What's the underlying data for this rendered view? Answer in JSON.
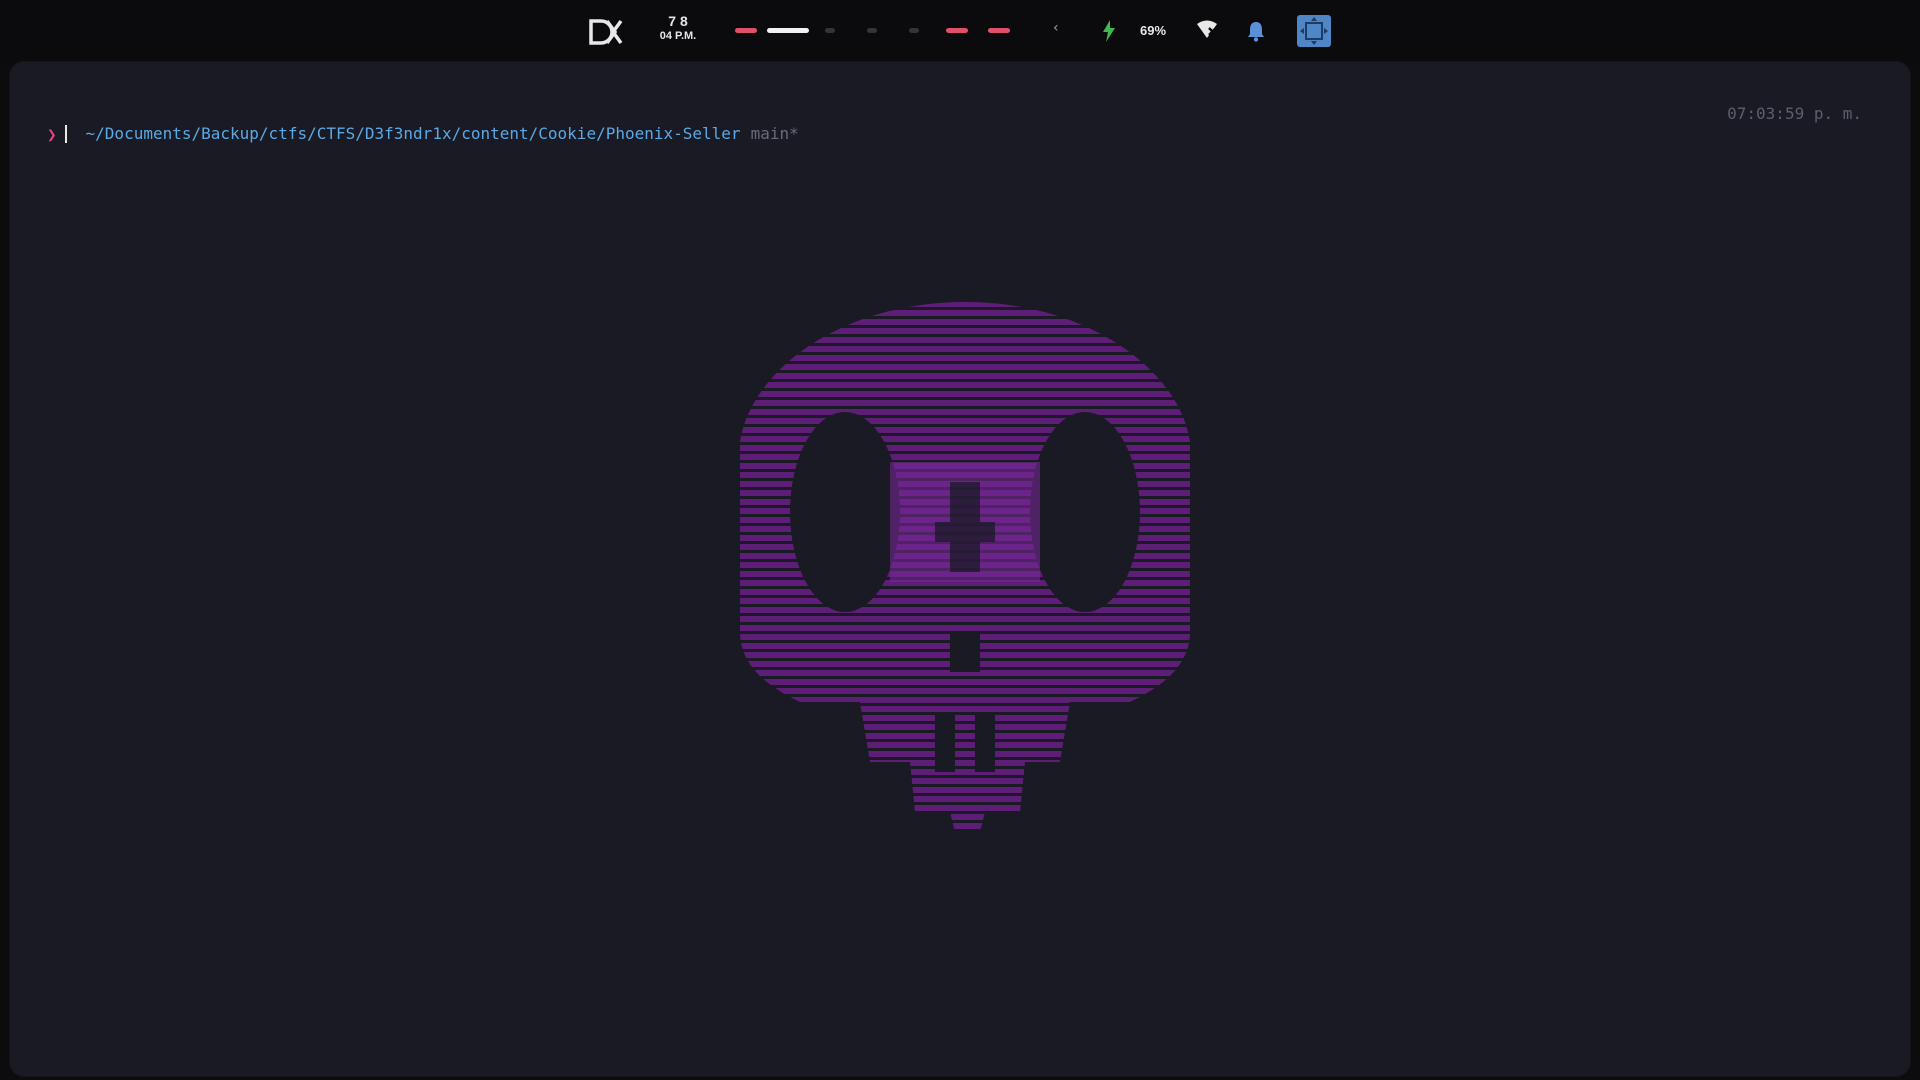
{
  "topbar": {
    "logo_icon": "dk-logo-icon",
    "clock_hour": "7 8",
    "clock_time": "04 P.M.",
    "workspaces": [
      {
        "state": "active-red",
        "color": "#e0506a"
      },
      {
        "state": "focused",
        "color": "#f2f2f2"
      },
      {
        "state": "empty",
        "color": "#333338"
      },
      {
        "state": "empty",
        "color": "#333338"
      },
      {
        "state": "empty",
        "color": "#333338"
      },
      {
        "state": "active-red",
        "color": "#e0506a"
      },
      {
        "state": "active-red",
        "color": "#e0506a"
      }
    ],
    "tray_expand_icon": "chevron-left-icon",
    "charging_icon": "bolt-icon",
    "battery_percent": "69%",
    "network_icon": "wifi-icon",
    "notification_icon": "bell-icon",
    "layout_icon": "layout-float-icon",
    "accent_color": "#4f86c6"
  },
  "terminal": {
    "cwd": "~/Documents/Backup/ctfs/CTFS/D3f3ndr1x/content/Cookie/Phoenix-Seller",
    "git_branch": "main*",
    "right_prompt_time": "07:03:59 p. m.",
    "prompt_symbol": "❯",
    "input_value": "",
    "background_art_icon": "skull-icon",
    "colors": {
      "background": "#1a1a24",
      "path": "#5aa9e6",
      "branch": "#6b6b78",
      "prompt": "#e0457b",
      "art": "#6a1f86"
    }
  }
}
